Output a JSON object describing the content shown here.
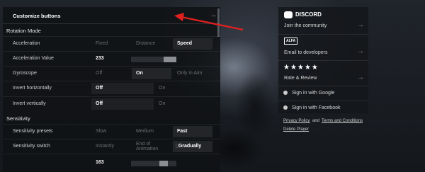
{
  "header": {
    "title": "Customize buttons",
    "arrow": "→"
  },
  "sections": {
    "rotation": "Rotation Mode",
    "sensitivity": "Sensitivity"
  },
  "rows": {
    "acceleration": {
      "label": "Acceleration",
      "options": [
        "Fixed",
        "Distance",
        "Speed"
      ],
      "selected": "Speed"
    },
    "acceleration_value": {
      "label": "Acceleration Value",
      "value": "233",
      "slider_fraction": 0.78
    },
    "gyroscope": {
      "label": "Gyroscope",
      "options": [
        "Off",
        "On",
        "Only in Aim"
      ],
      "selected": "On"
    },
    "invert_h": {
      "label": "Invert horizontally",
      "options": [
        "Off",
        "On"
      ],
      "selected": "Off"
    },
    "invert_v": {
      "label": "Invert vertically",
      "options": [
        "Off",
        "On"
      ],
      "selected": "Off"
    },
    "presets": {
      "label": "Sensitivity presets",
      "options": [
        "Slow",
        "Medium",
        "Fast"
      ],
      "selected": "Fast"
    },
    "switch": {
      "label": "Sensitivity switch",
      "options": [
        "Instantly",
        "End of",
        "Animation",
        "Gradually"
      ],
      "selected": "Gradually"
    },
    "partial": {
      "value": "163"
    }
  },
  "right_panel": {
    "discord": "DISCORD",
    "community": "Join the community",
    "alfa": "ALFA",
    "email": "Email to developers",
    "stars": "★★★★★",
    "rate": "Rate & Review",
    "google": "Sign in with Google",
    "facebook": "Sign in with Facebook",
    "arrow": "→"
  },
  "footer": {
    "privacy": "Privacy Policy",
    "and": "and",
    "terms": "Terms and Conditions",
    "delete": "Delete Player"
  },
  "colors": {
    "annotation_arrow": "#e0201f"
  }
}
